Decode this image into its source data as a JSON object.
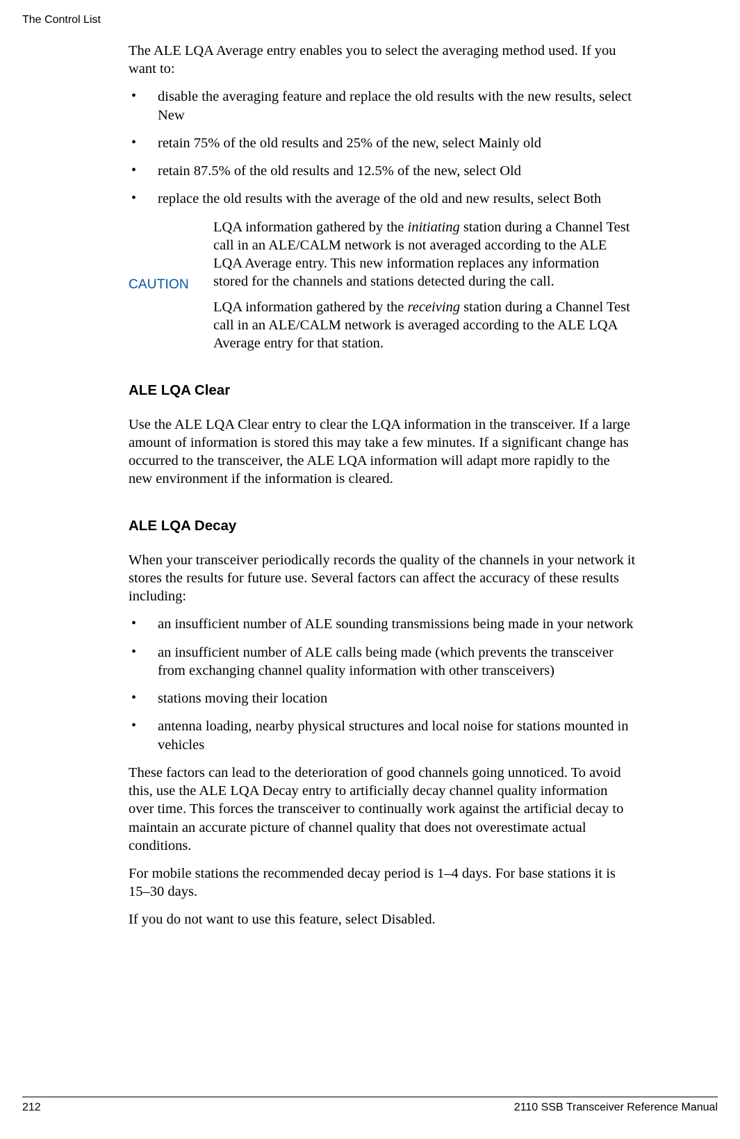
{
  "header": {
    "running_title": "The Control List"
  },
  "body": {
    "intro": "The ALE LQA Average entry enables you to select the averaging method used. If you want to:",
    "bullets_avg": [
      "disable the averaging feature and replace the old results with the new results, select New",
      "retain 75% of the old results and 25% of the new, select Mainly old",
      "retain 87.5% of the old results and 12.5% of the new, select Old",
      "replace the old results with the average of the old and new results, select Both"
    ],
    "caution": {
      "label": "CAUTION",
      "p1_pre": "LQA information gathered by the ",
      "p1_em": "initiating",
      "p1_post": " station during a Channel Test call in an ALE/CALM network is not averaged according to the ALE LQA Average entry. This new information replaces any information stored for the channels and stations detected during the call.",
      "p2_pre": "LQA information gathered by the ",
      "p2_em": "receiving",
      "p2_post": " station during a Channel Test call in an ALE/CALM network is averaged according to the ALE LQA Average entry for that station."
    },
    "section_clear": {
      "heading": "ALE LQA Clear",
      "p1": "Use the ALE LQA Clear entry to clear the LQA information in the transceiver. If a large amount of information is stored this may take a few minutes. If a significant change has occurred to the transceiver, the ALE LQA information will adapt more rapidly to the new environment if the information is cleared."
    },
    "section_decay": {
      "heading": "ALE LQA Decay",
      "p1": "When your transceiver periodically records the quality of the channels in your network it stores the results for future use. Several factors can affect the accuracy of these results including:",
      "bullets": [
        "an insufficient number of ALE sounding transmissions being made in your network",
        "an insufficient number of ALE calls being made (which prevents the transceiver from exchanging channel quality information with other transceivers)",
        "stations moving their location",
        "antenna loading, nearby physical structures and local noise for stations mounted in vehicles"
      ],
      "p2": "These factors can lead to the deterioration of good channels going unnoticed. To avoid this, use the ALE LQA Decay entry to artificially decay channel quality information over time. This forces the transceiver to continually work against the artificial decay to maintain an accurate picture of channel quality that does not overestimate actual conditions.",
      "p3": "For mobile stations the recommended decay period is 1–4 days. For base stations it is 15–30 days.",
      "p4": "If you do not want to use this feature, select Disabled."
    }
  },
  "footer": {
    "page_number": "212",
    "manual_title": "2110 SSB Transceiver Reference Manual"
  }
}
